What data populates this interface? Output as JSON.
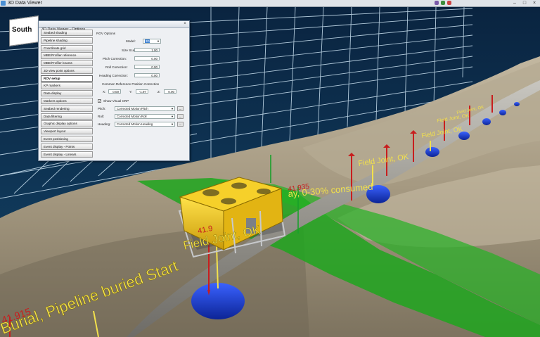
{
  "window": {
    "title": "3D Data Viewer",
    "min": "–",
    "max": "□",
    "close": "×"
  },
  "compass": {
    "label": "South"
  },
  "dialog": {
    "title": "3D Data Viewer - Options",
    "close": "×",
    "nav": [
      "Seabed shading",
      "Pipeline shading",
      "Coordinate grid",
      "MBE/Profiler reference",
      "MBE/Profiler beams",
      "3D view point options",
      "ROV setup",
      "KP markers",
      "Data display",
      "Markers options",
      "Seabed rendering",
      "Data filtering",
      "Graphic display options",
      "Viewport layout",
      "Event positioning",
      "Event display - Points",
      "Event display - Linears"
    ],
    "active_index": 6,
    "rov": {
      "section": "ROV Options",
      "model_label": "Model:",
      "model_value": "3D",
      "size_label": "Size Scale:",
      "size_value": "1.00",
      "pitch_corr_label": "Pitch Correction:",
      "pitch_corr_value": "0.00",
      "roll_corr_label": "Roll Correction:",
      "roll_corr_value": "0.00",
      "heading_corr_label": "Heading Correction:",
      "heading_corr_value": "0.00",
      "crp_title": "Common Reference Position Correction",
      "x_label": "X:",
      "x_value": "0.00",
      "y_label": "Y:",
      "y_value": "-1.97",
      "z_label": "Z:",
      "z_value": "0.00",
      "show_crp_label": "Show Visual CRP",
      "pitch_label": "Pitch:",
      "pitch_value": "Corrected Motion Pitch",
      "roll_label": "Roll:",
      "roll_value": "Corrected Motion Roll",
      "heading_label": "Heading:",
      "heading_value": "Corrected Motion Heading",
      "dots": "..."
    }
  },
  "scene": {
    "labels": {
      "burial": "Burial, Pipeline buried Start",
      "kp_bottom": "41.915",
      "field_joint_1": "Field Joint, OK",
      "field_joint_2": "Field Joint, OK",
      "field_joint_3": "Field Joint, OK",
      "kp_mid": "41.9",
      "kp_right": "41.935",
      "consumed": "ay, 0-30% consumed",
      "small_1": "Field Joint, OK",
      "small_2": "Field Joint, OK"
    }
  },
  "colors": {
    "sky": "#0c2a46",
    "grid": "#cfe6f5",
    "seabed": "#a89d8a",
    "green_beam": "#1ea61e",
    "pipe": "#9a9892",
    "joint": "#1b3fd8",
    "label_yellow": "#f2e14c",
    "marker_red": "#c81e1e",
    "rov_yellow": "#f0c419"
  }
}
